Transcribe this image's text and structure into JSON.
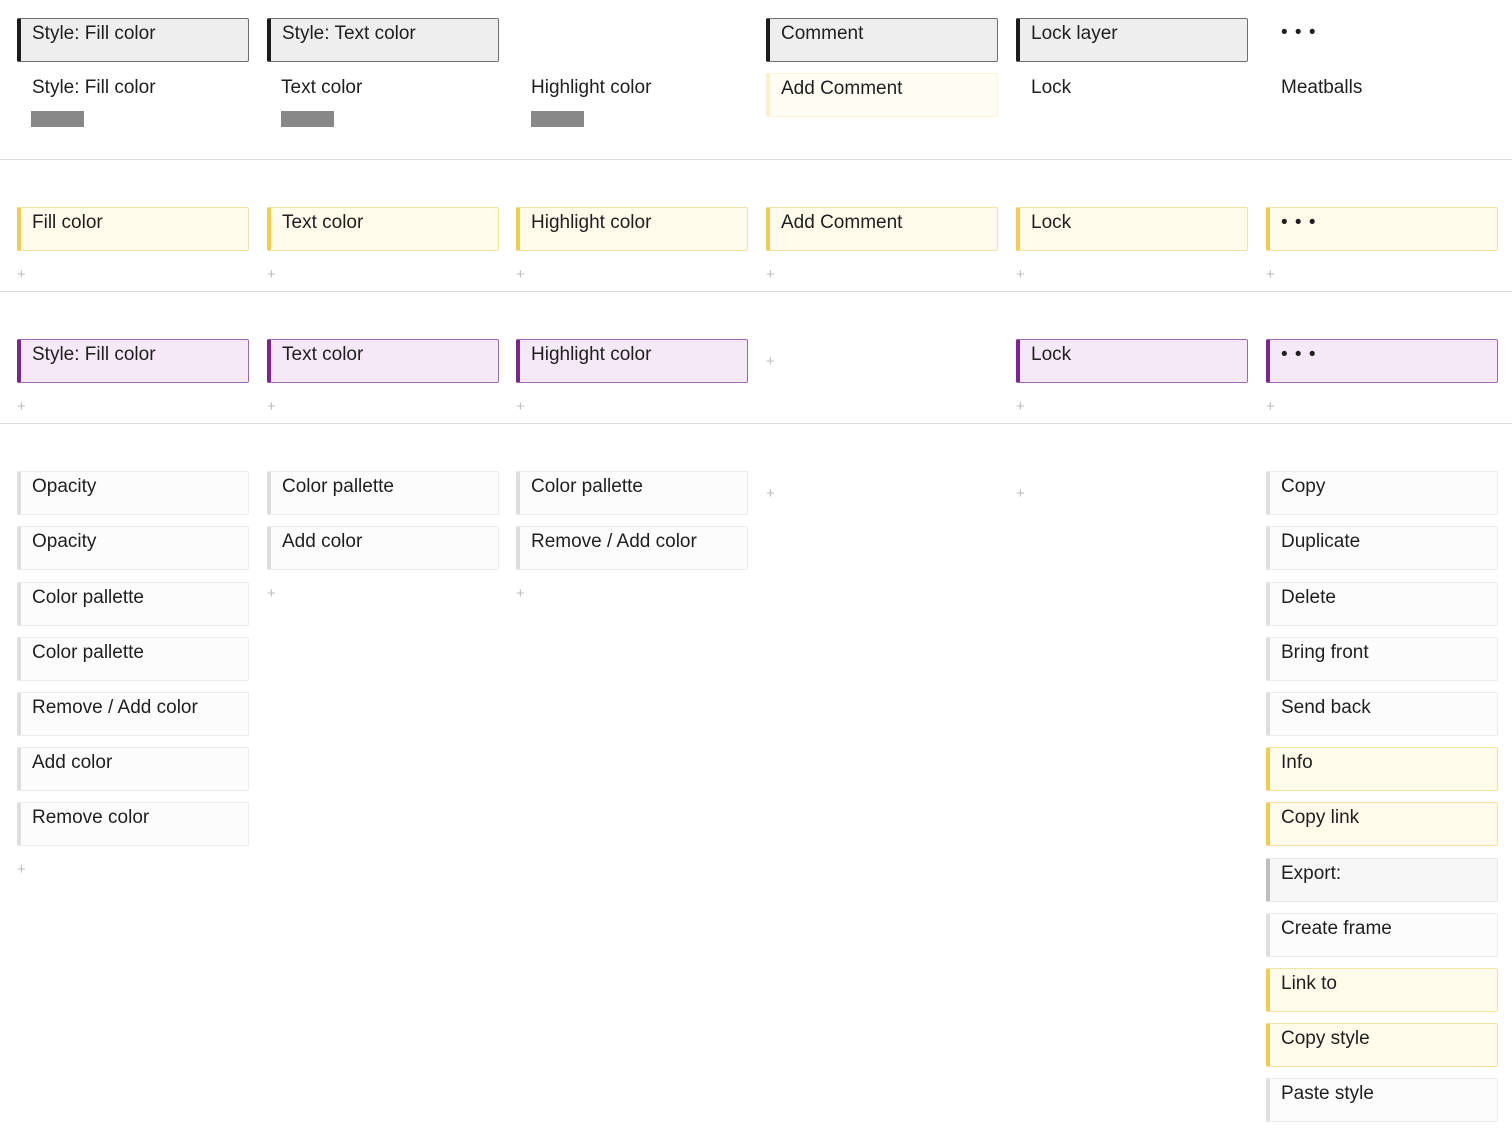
{
  "row1": {
    "headers": [
      "Style: Fill color",
      "Style: Text color",
      "Comment",
      "Lock layer",
      "• • •"
    ],
    "labels": [
      "Style: Fill color",
      "Text color",
      "Highlight color",
      "Add Comment",
      "Lock",
      "Meatballs"
    ]
  },
  "row2": {
    "cards": [
      "Fill color",
      "Text color",
      "Highlight color",
      "Add Comment",
      "Lock",
      "• • •"
    ]
  },
  "row3": {
    "cards": [
      "Style: Fill color",
      "Text color",
      "Highlight color",
      "Lock",
      "• • •"
    ]
  },
  "row4": {
    "col1": [
      "Opacity",
      "Opacity",
      "Color pallette",
      "Color pallette",
      "Remove / Add color",
      "Add color",
      "Remove color"
    ],
    "col2": [
      "Color pallette",
      "Add color"
    ],
    "col3": [
      "Color pallette",
      "Remove / Add color"
    ],
    "col6": [
      "Copy",
      "Duplicate",
      "Delete",
      "Bring front",
      "Send back",
      "Info",
      "Copy link",
      "Export:",
      "Create frame",
      "Link to",
      "Copy style",
      "Paste style"
    ]
  },
  "plus_glyph": "+",
  "colors": {
    "header_border": "#1c1c1c",
    "yellow_accent": "#f2cc4e",
    "purple_accent": "#7a2592",
    "swatch": "#888888"
  }
}
